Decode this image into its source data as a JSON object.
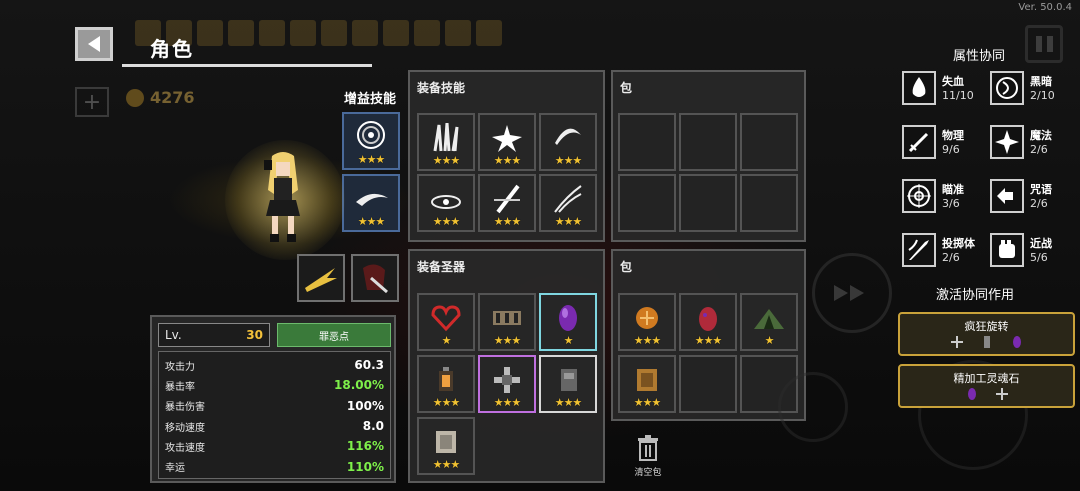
{
  "version": "Ver. 50.0.4",
  "header": {
    "title": "角色",
    "gold": "4276"
  },
  "buff_section": {
    "title": "增益技能",
    "slots": [
      {
        "stars": "★★★"
      },
      {
        "stars": "★★★"
      }
    ]
  },
  "equipped_skills": {
    "title": "装备技能",
    "slots": [
      {
        "icon": "claw-slash-icon",
        "stars": "★★★"
      },
      {
        "icon": "burst-icon",
        "stars": "★★★"
      },
      {
        "icon": "spin-slash-icon",
        "stars": "★★★"
      },
      {
        "icon": "whirl-icon",
        "stars": "★★★"
      },
      {
        "icon": "cross-blade-icon",
        "stars": "★★★"
      },
      {
        "icon": "wind-blade-icon",
        "stars": "★★★"
      }
    ]
  },
  "skill_bag": {
    "title": "包"
  },
  "equipped_relics": {
    "title": "装备圣器",
    "slots": [
      {
        "icon": "red-heart-relic-icon",
        "stars": "★"
      },
      {
        "icon": "hourglass-relic-icon",
        "stars": "★★★"
      },
      {
        "icon": "purple-gem-relic-icon",
        "stars": "★"
      },
      {
        "icon": "lantern-relic-icon",
        "stars": "★★★"
      },
      {
        "icon": "crosshair-relic-icon",
        "stars": "★★★"
      },
      {
        "icon": "spirit-stone-relic-icon",
        "stars": "★★★"
      },
      {
        "icon": "crate-relic-icon",
        "stars": "★★★"
      }
    ]
  },
  "relic_bag": {
    "title": "包",
    "slots": [
      {
        "icon": "orange-coin-icon",
        "stars": "★★★"
      },
      {
        "icon": "red-egg-icon",
        "stars": "★★★"
      },
      {
        "icon": "tent-icon",
        "stars": "★"
      },
      {
        "icon": "wood-crate-icon",
        "stars": "★★★"
      }
    ]
  },
  "stats": {
    "lv_label": "Lv.",
    "lv_value": "30",
    "sin_button": "罪恶点",
    "rows": [
      {
        "label": "攻击力",
        "value": "60.3",
        "color": "#ffffff"
      },
      {
        "label": "暴击率",
        "value": "18.00%",
        "color": "#7ef04a"
      },
      {
        "label": "暴击伤害",
        "value": "100%",
        "color": "#ffffff"
      },
      {
        "label": "移动速度",
        "value": "8.0",
        "color": "#ffffff"
      },
      {
        "label": "攻击速度",
        "value": "116%",
        "color": "#7ef04a"
      },
      {
        "label": "幸运",
        "value": "110%",
        "color": "#7ef04a"
      }
    ]
  },
  "trash": {
    "label": "清空包"
  },
  "synergies": {
    "title": "属性协同",
    "items": [
      {
        "name": "失血",
        "count": "11/10",
        "icon": "blood-drop-icon"
      },
      {
        "name": "黑暗",
        "count": "2/10",
        "icon": "dark-moon-icon"
      },
      {
        "name": "物理",
        "count": "9/6",
        "icon": "sword-icon"
      },
      {
        "name": "魔法",
        "count": "2/6",
        "icon": "magic-star-icon"
      },
      {
        "name": "瞄准",
        "count": "3/6",
        "icon": "target-icon"
      },
      {
        "name": "咒语",
        "count": "2/6",
        "icon": "spell-icon"
      },
      {
        "name": "投掷体",
        "count": "2/6",
        "icon": "projectile-icon"
      },
      {
        "name": "近战",
        "count": "5/6",
        "icon": "fist-icon"
      }
    ]
  },
  "active_synergies": {
    "title": "激活协同作用",
    "items": [
      {
        "name": "疯狂旋转"
      },
      {
        "name": "精加工灵魂石"
      }
    ]
  },
  "colors": {
    "star": "#f1c232",
    "green": "#7ef04a",
    "gold_border": "#c9a23a"
  }
}
